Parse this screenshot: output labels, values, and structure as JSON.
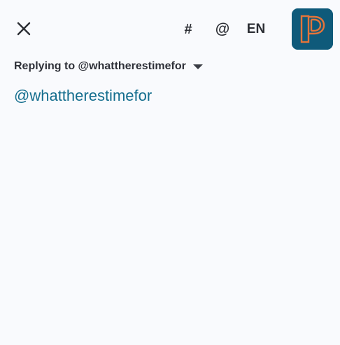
{
  "toolbar": {
    "close_icon": "close-icon",
    "hashtag_label": "#",
    "mention_label": "@",
    "language_label": "EN",
    "avatar_icon": "profile-avatar-p-logo",
    "avatar_color": "#0f5a7a",
    "avatar_accent": "#e3743a"
  },
  "reply": {
    "label": "Replying to @whattherestimefor",
    "chevron_icon": "chevron-down-icon"
  },
  "compose": {
    "value": "@whattherestimefor"
  },
  "colors": {
    "background": "#f9fafd",
    "mention_text": "#156e8e",
    "text": "#2e3038"
  }
}
